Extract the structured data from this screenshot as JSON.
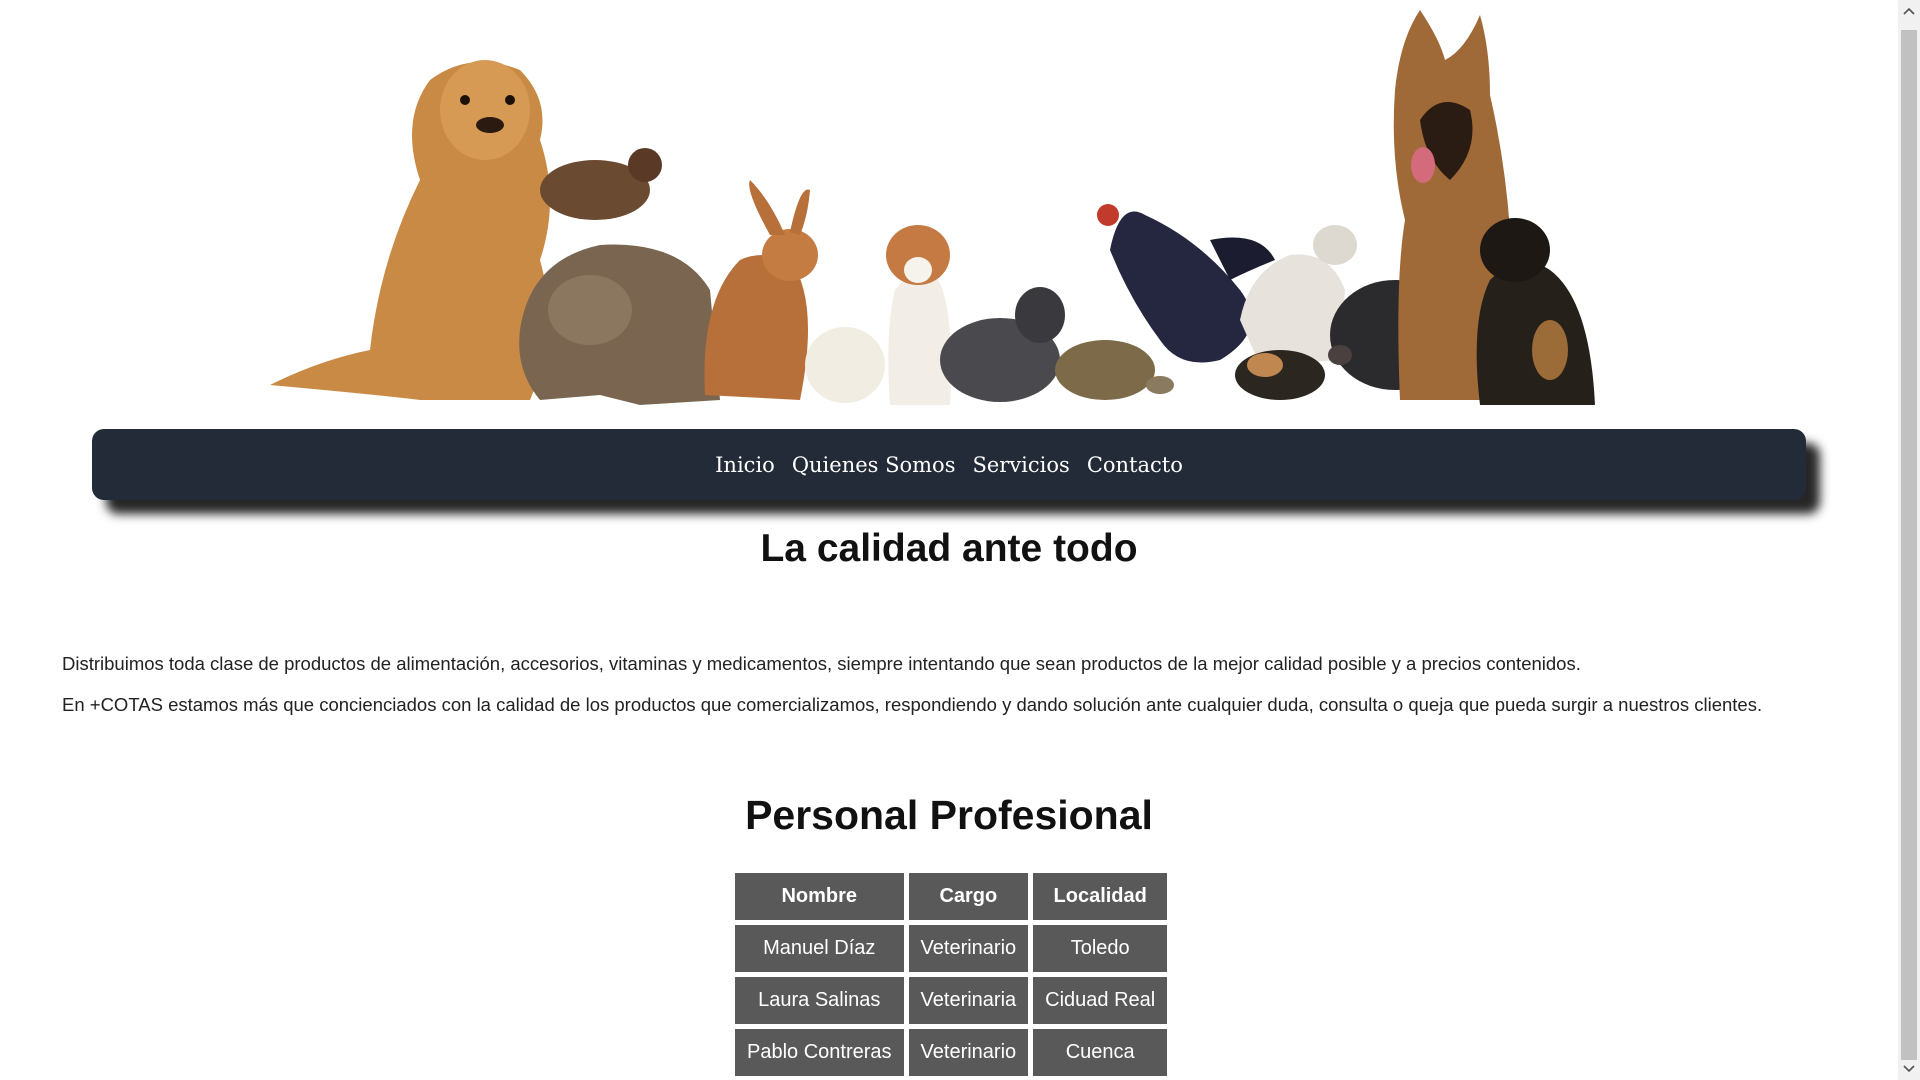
{
  "nav": {
    "items": [
      {
        "label": "Inicio"
      },
      {
        "label": "Quienes Somos"
      },
      {
        "label": "Servicios"
      },
      {
        "label": "Contacto"
      }
    ]
  },
  "main": {
    "title": "La calidad ante todo",
    "paragraphs": [
      "Distribuimos toda clase de productos de alimentación, accesorios, vitaminas y medicamentos, siempre intentando que sean productos de la mejor calidad posible y a precios contenidos.",
      "En +COTAS estamos más que concienciados con la calidad de los productos que comercializamos, respondiendo y dando solución ante cualquier duda, consulta o queja que pueda surgir a nuestros clientes."
    ]
  },
  "staff": {
    "title": "Personal Profesional",
    "columns": [
      "Nombre",
      "Cargo",
      "Localidad"
    ],
    "rows": [
      [
        "Manuel Díaz",
        "Veterinario",
        "Toledo"
      ],
      [
        "Laura Salinas",
        "Veterinaria",
        "Ciduad Real"
      ],
      [
        "Pablo Contreras",
        "Veterinario",
        "Cuenca"
      ]
    ]
  },
  "colors": {
    "nav_background": "#222b37",
    "table_cell": "#595959"
  },
  "banner": {
    "icon": "pets-banner-image"
  }
}
